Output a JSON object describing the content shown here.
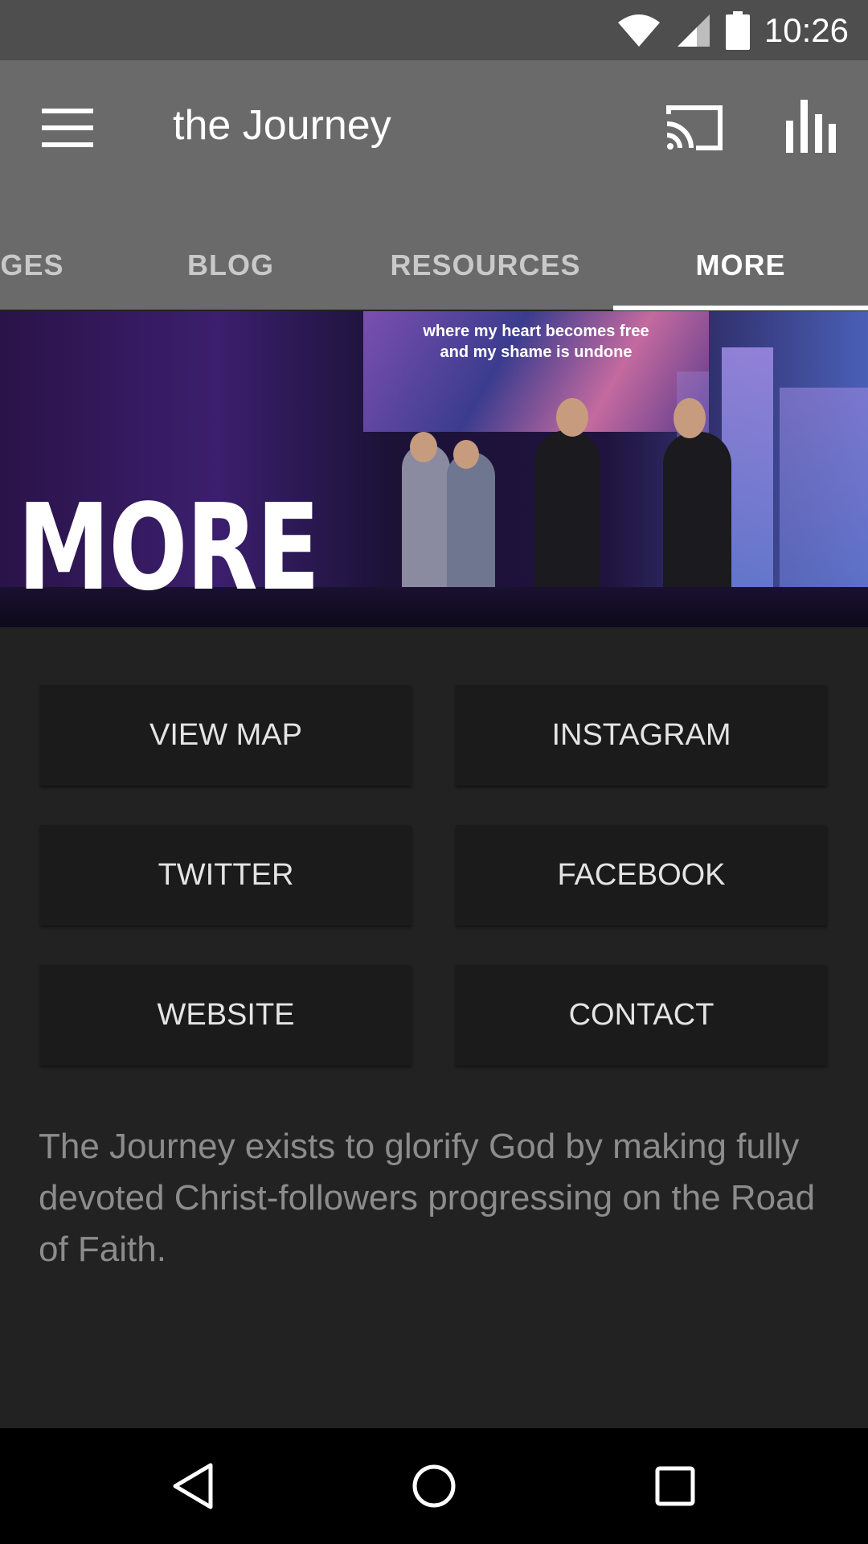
{
  "status_bar": {
    "time": "10:26",
    "icons": [
      "wifi-icon",
      "signal-icon",
      "battery-icon"
    ]
  },
  "app_bar": {
    "title": "the Journey",
    "icons": [
      "menu-icon",
      "cast-icon",
      "chart-icon"
    ]
  },
  "tabs": {
    "items": [
      {
        "label": "GES"
      },
      {
        "label": "BLOG"
      },
      {
        "label": "RESOURCES"
      },
      {
        "label": "MORE",
        "active": true
      }
    ]
  },
  "banner": {
    "title": "MORE",
    "screen_lyrics": [
      "where my heart becomes free",
      "and my shame is undone"
    ]
  },
  "buttons": {
    "view_map": "VIEW MAP",
    "instagram": "INSTAGRAM",
    "twitter": "TWITTER",
    "facebook": "FACEBOOK",
    "website": "WEBSITE",
    "contact": "CONTACT"
  },
  "description": "The Journey exists to glorify God by making fully devoted Christ-followers progressing on the Road of Faith.",
  "nav_bar": {
    "icons": [
      "back-icon",
      "home-icon",
      "recents-icon"
    ]
  },
  "colors": {
    "status_bar": "#4e4e4e",
    "app_bar": "#6a6a6a",
    "background": "#222222",
    "button": "#1b1b1b",
    "nav_bar": "#000000"
  }
}
